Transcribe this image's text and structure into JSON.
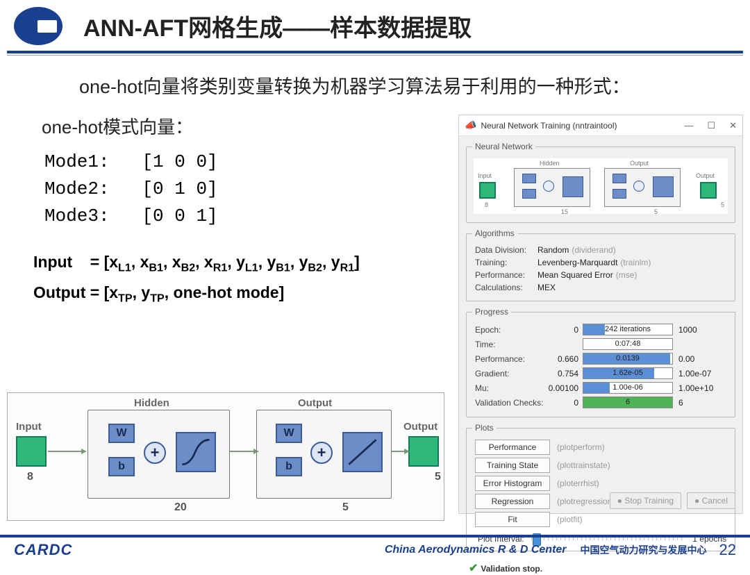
{
  "title": "ANN-AFT网格生成——样本数据提取",
  "body_text": "one-hot向量将类别变量转换为机器学习算法易于利用的一种形式：",
  "subhead": "one-hot模式向量：",
  "modes": [
    {
      "label": "Mode1:",
      "vec": "[1  0  0]"
    },
    {
      "label": "Mode2:",
      "vec": "[0  1  0]"
    },
    {
      "label": "Mode3:",
      "vec": "[0  0  1]"
    }
  ],
  "io": {
    "input_label": "Input",
    "input_eq": " = [x",
    "input_subs": [
      "L1",
      "B1",
      "B2",
      "R1"
    ],
    "input_mid": ", y",
    "input_ysubs": [
      "L1",
      "B1",
      "B2",
      "R1"
    ],
    "input_close": "]",
    "output_label": "Output = [x",
    "output_subs": [
      "TP"
    ],
    "output_mid": ", y",
    "output_ysubs": [
      "TP"
    ],
    "output_tail": ", one-hot mode]"
  },
  "diagram_big": {
    "input_label": "Input",
    "hidden_label": "Hidden",
    "output_label": "Output",
    "out_right": "Output",
    "in_count": "8",
    "hidden_count": "20",
    "out_count": "5",
    "out_right_count": "5",
    "W": "W",
    "b": "b",
    "plus": "+"
  },
  "nntool": {
    "title": "Neural Network Training (nntraintool)",
    "ctrl_min": "—",
    "ctrl_box": "☐",
    "ctrl_close": "✕",
    "legend_nn": "Neural Network",
    "nn_mini": {
      "input": "Input",
      "hidden": "Hidden",
      "output": "Output",
      "out2": "Output",
      "in_n": "8",
      "hid_n": "15",
      "out_n": "5",
      "out2_n": "5"
    },
    "legend_alg": "Algorithms",
    "algorithms": [
      {
        "k": "Data Division:",
        "v": "Random",
        "s": "(dividerand)"
      },
      {
        "k": "Training:",
        "v": "Levenberg-Marquardt",
        "s": "(trainlm)"
      },
      {
        "k": "Performance:",
        "v": "Mean Squared Error",
        "s": "(mse)"
      },
      {
        "k": "Calculations:",
        "v": "MEX",
        "s": ""
      }
    ],
    "legend_prog": "Progress",
    "progress": [
      {
        "k": "Epoch:",
        "start": "0",
        "text": "242 iterations",
        "end": "1000",
        "fill": 24,
        "cls": ""
      },
      {
        "k": "Time:",
        "start": "",
        "text": "0:07:48",
        "end": "",
        "fill": 0,
        "cls": ""
      },
      {
        "k": "Performance:",
        "start": "0.660",
        "text": "0.0139",
        "end": "0.00",
        "fill": 98,
        "cls": ""
      },
      {
        "k": "Gradient:",
        "start": "0.754",
        "text": "1.62e-05",
        "end": "1.00e-07",
        "fill": 80,
        "cls": ""
      },
      {
        "k": "Mu:",
        "start": "0.00100",
        "text": "1.00e-06",
        "end": "1.00e+10",
        "fill": 30,
        "cls": ""
      },
      {
        "k": "Validation Checks:",
        "start": "0",
        "text": "6",
        "end": "6",
        "fill": 100,
        "cls": "green"
      }
    ],
    "legend_plots": "Plots",
    "plots": [
      {
        "btn": "Performance",
        "sub": "(plotperform)"
      },
      {
        "btn": "Training State",
        "sub": "(plottrainstate)"
      },
      {
        "btn": "Error Histogram",
        "sub": "(ploterrhist)"
      },
      {
        "btn": "Regression",
        "sub": "(plotregression)"
      },
      {
        "btn": "Fit",
        "sub": "(plotfit)"
      }
    ],
    "plot_interval_label": "Plot Interval:",
    "plot_interval_val": "1 epochs",
    "val_stop": "Validation stop.",
    "btn_stop": "Stop Training",
    "btn_cancel": "Cancel"
  },
  "footer": {
    "cardc": "CARDC",
    "center_en": "China Aerodynamics R & D Center",
    "center_cn": "中国空气动力研究与发展中心",
    "page": "22"
  }
}
